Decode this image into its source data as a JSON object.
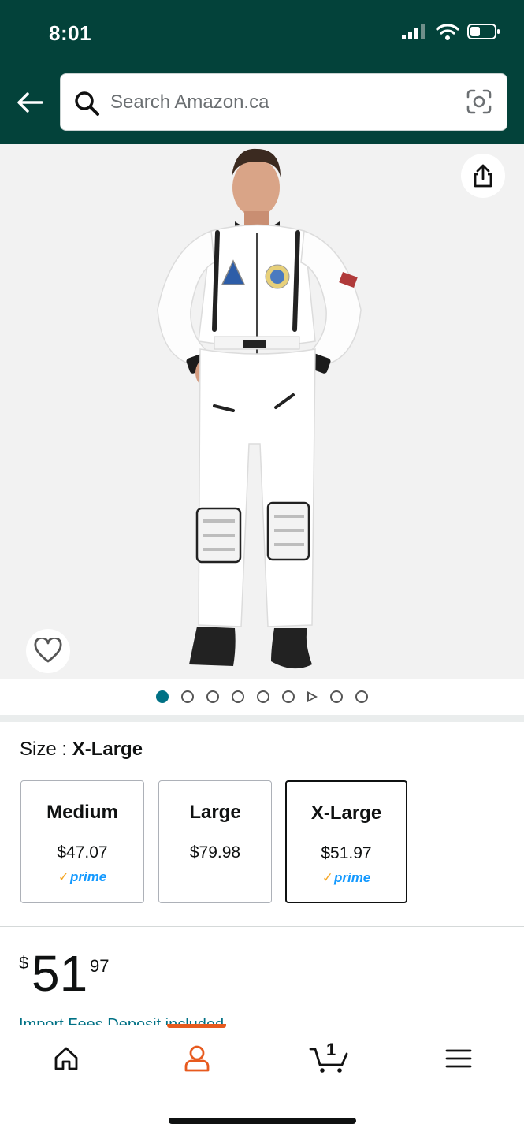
{
  "status_bar": {
    "time": "8:01",
    "icons": [
      "signal-icon",
      "wifi-icon",
      "battery-icon"
    ]
  },
  "header": {
    "back_icon": "arrow-left-icon",
    "search_placeholder": "Search Amazon.ca",
    "search_icon": "search-icon",
    "camera_icon": "camera-scan-icon",
    "background_color": "#03423a"
  },
  "gallery": {
    "image_alt": "Astronaut costume — white jumpsuit",
    "share_icon": "share-icon",
    "favorite_icon": "heart-icon",
    "pager": {
      "count_before_video": 6,
      "has_video": true,
      "count_after_video": 2,
      "active_index": 0
    }
  },
  "size_selector": {
    "label_prefix": "Size : ",
    "selected": "X-Large",
    "options": [
      {
        "name": "Medium",
        "price": "$47.07",
        "prime": true
      },
      {
        "name": "Large",
        "price": "$79.98",
        "prime": false
      },
      {
        "name": "X-Large",
        "price": "$51.97",
        "prime": true,
        "selected": true
      }
    ],
    "prime_text": "prime",
    "prime_check": "✓"
  },
  "price": {
    "currency": "$",
    "whole": "51",
    "fraction": "97",
    "teaser": "Import Fees Deposit included"
  },
  "bottom_nav": {
    "items": [
      {
        "name": "home",
        "icon": "home-icon"
      },
      {
        "name": "account",
        "icon": "person-icon",
        "active": true
      },
      {
        "name": "cart",
        "icon": "cart-icon",
        "badge": "1"
      },
      {
        "name": "menu",
        "icon": "hamburger-menu-icon"
      }
    ],
    "active_color": "#e75a1e"
  }
}
